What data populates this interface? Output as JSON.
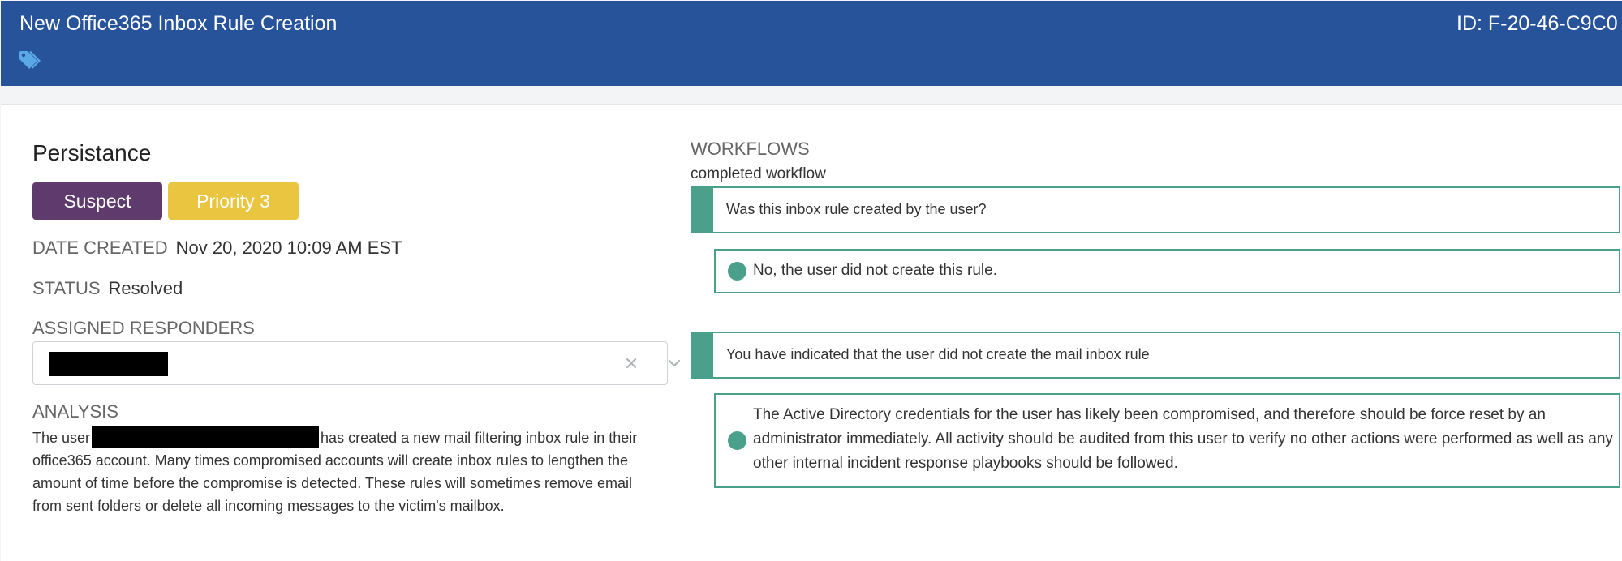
{
  "header": {
    "title": "New Office365 Inbox Rule Creation",
    "incident_id": "ID: F-20-46-C9C0",
    "tag_icon": "tags-icon",
    "background_color": "#27539b"
  },
  "details": {
    "category": "Persistance",
    "badges": {
      "suspect": "Suspect",
      "priority": "Priority 3"
    },
    "date_created_label": "DATE CREATED",
    "date_created_value": "Nov 20, 2020 10:09 AM EST",
    "status_label": "STATUS",
    "status_value": "Resolved",
    "assigned_responders_label": "ASSIGNED RESPONDERS",
    "analysis_label": "ANALYSIS",
    "analysis_before": "The user",
    "analysis_after": "has created a new mail filtering inbox rule in their office365 account. Many times compromised accounts will create inbox rules to lengthen the amount of time before the compromise is detected. These rules will sometimes remove email from sent folders or delete all incoming messages to the victim's mailbox."
  },
  "workflows": {
    "title": "WORKFLOWS",
    "subtitle": "completed workflow",
    "steps": [
      {
        "question": "Was this inbox rule created by the user?",
        "answer": "No, the user did not create this rule."
      },
      {
        "question": "You have indicated that the user did not create the mail inbox rule",
        "answer": "The Active Directory credentials for the user has likely been compromised, and therefore should be force reset by an administrator immediately. All activity should be audited from this user to verify no other actions were performed as well as any other internal incident response playbooks should be followed."
      }
    ]
  },
  "colors": {
    "suspect": "#5e3a6d",
    "priority": "#eac640",
    "workflow_accent": "#4aa08a"
  }
}
